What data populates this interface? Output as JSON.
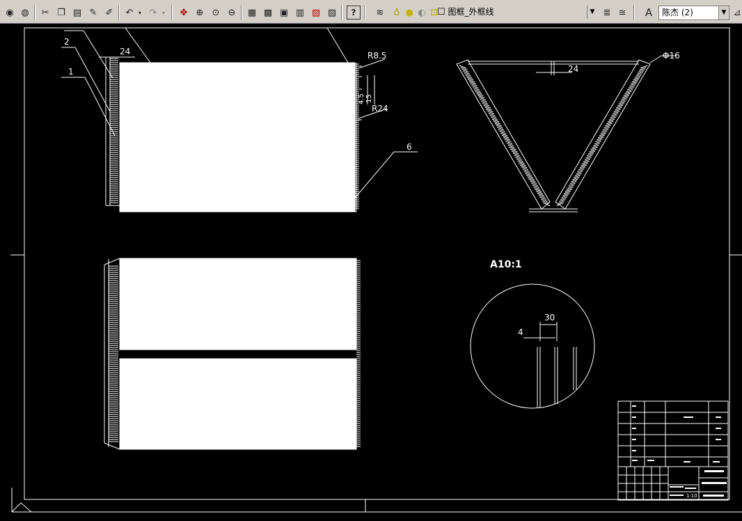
{
  "toolbar": {
    "layer_combo_value": "图框_外框线",
    "text_style_combo_value": "陈杰 (2)",
    "layer_state_glyph": "☐",
    "help_glyph": "?"
  },
  "drawing": {
    "callout_labels": [
      "2",
      "1",
      "6"
    ],
    "dim_top_left": "24",
    "dim_r85": "R8.5",
    "dim_r24": "R24",
    "dim_15": "15",
    "dim_v_small": "4.5",
    "dim_phi16": "Φ16",
    "dim_v_24": "24",
    "detail_label": "A10:1",
    "detail_dim_30": "30",
    "detail_dim_4": "4"
  },
  "title_block": {
    "scale": "1:10"
  },
  "colors": {
    "background": "#000000",
    "lines": "#ffffff",
    "toolbar": "#d4d0c8"
  }
}
